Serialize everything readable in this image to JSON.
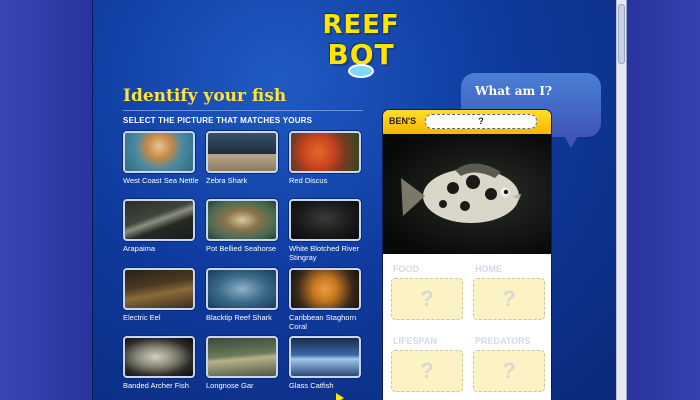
{
  "logo": {
    "line1": "REEF",
    "line2": "BOT"
  },
  "heading": "Identify your fish",
  "subheading": "SELECT THE PICTURE THAT MATCHES YOURS",
  "fish": [
    {
      "label": "West Coast Sea Nettle"
    },
    {
      "label": "Zebra Shark"
    },
    {
      "label": "Red Discus"
    },
    {
      "label": "Arapaima"
    },
    {
      "label": "Pot Bellied Seahorse"
    },
    {
      "label": "White Blotched River Stingray"
    },
    {
      "label": "Electric Eel"
    },
    {
      "label": "Blacktip Reef Shark"
    },
    {
      "label": "Caribbean Staghorn Coral"
    },
    {
      "label": "Banded Archer Fish"
    },
    {
      "label": "Longnose Gar"
    },
    {
      "label": "Glass Catfish"
    }
  ],
  "bubble": {
    "text": "What am I?"
  },
  "card": {
    "owner": "BEN'S",
    "answer": "?",
    "fields": [
      {
        "label": "FOOD",
        "value": "?"
      },
      {
        "label": "HOME",
        "value": "?"
      },
      {
        "label": "LIFESPAN",
        "value": "?"
      },
      {
        "label": "PREDATORS",
        "value": "?"
      }
    ]
  },
  "colors": {
    "accent": "#ffe23a",
    "background": "#0f3a9e",
    "card_header": "#f7b500"
  }
}
